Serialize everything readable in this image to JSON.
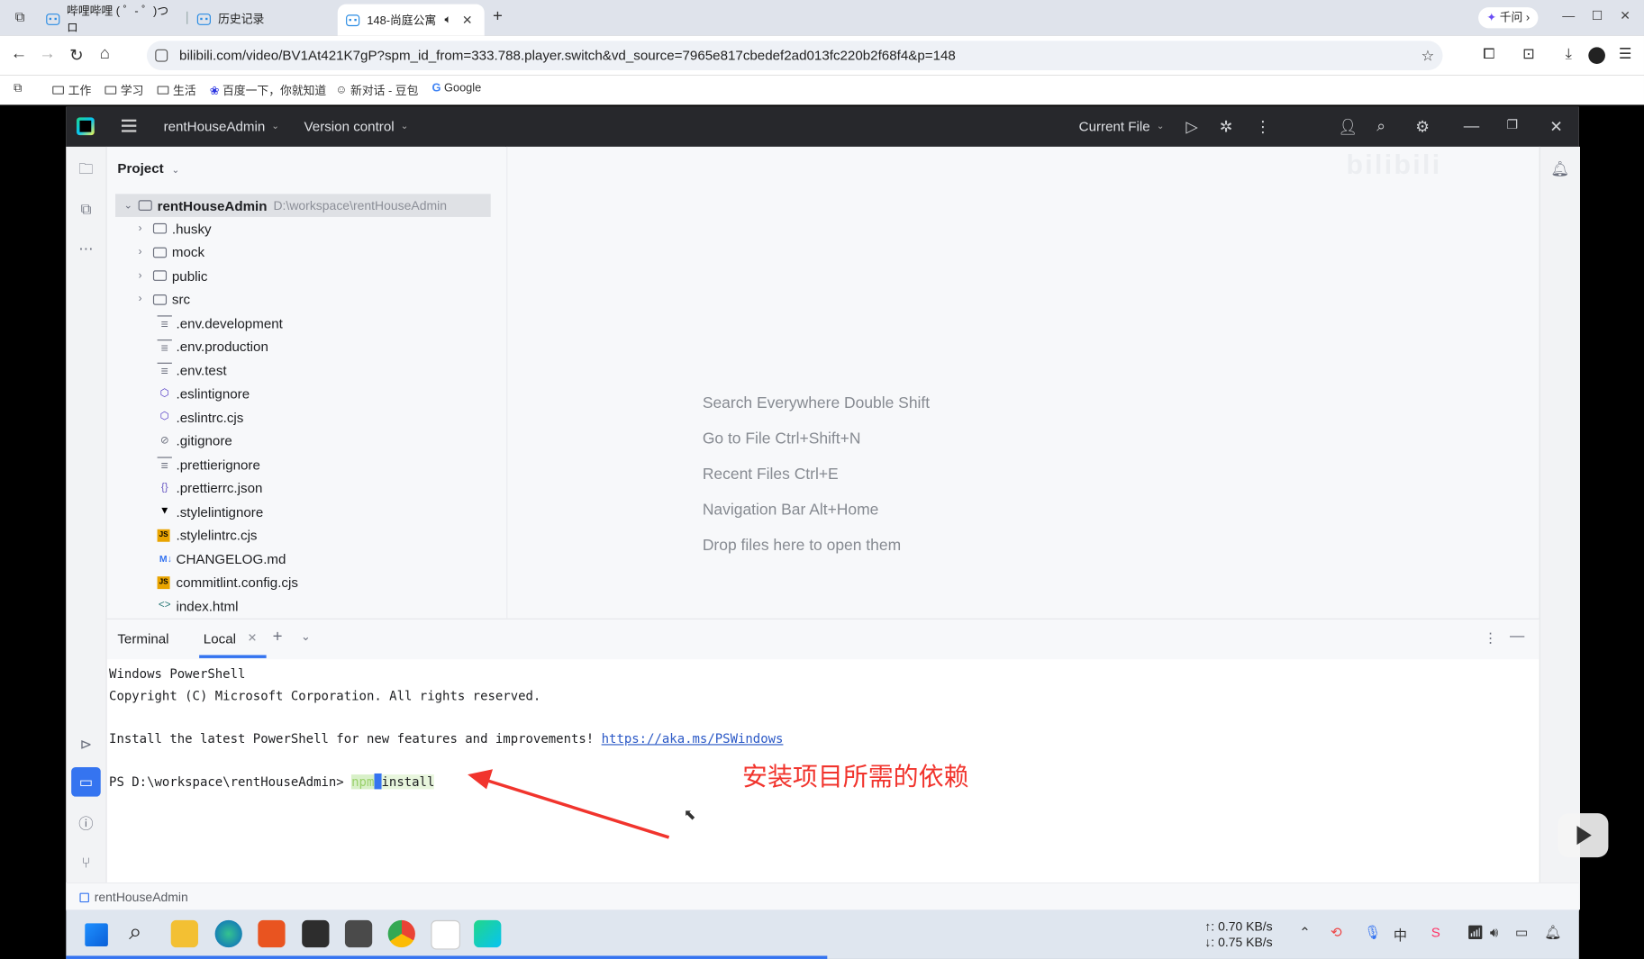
{
  "browser": {
    "tabs": [
      {
        "label": "哔哩哔哩 ( ゜- ゜)つロ"
      },
      {
        "label": "历史记录"
      },
      {
        "label": "148-尚庭公寓"
      }
    ],
    "qianwen": "千问",
    "url": "bilibili.com/video/BV1At421K7gP?spm_id_from=333.788.player.switch&vd_source=7965e817cbedef2ad013fc220b2f68f4&p=148",
    "bookmarks": [
      "工作",
      "学习",
      "生活",
      "百度一下，你就知道",
      "新对话 - 豆包",
      "Google"
    ]
  },
  "ide": {
    "project_name": "rentHouseAdmin",
    "version_control": "Version control",
    "run_config": "Current File",
    "project_panel_title": "Project",
    "root": {
      "name": "rentHouseAdmin",
      "path": "D:\\workspace\\rentHouseAdmin"
    },
    "folders": [
      ".husky",
      "mock",
      "public",
      "src"
    ],
    "files": [
      {
        "name": ".env.development",
        "icon": "text-file-icon"
      },
      {
        "name": ".env.production",
        "icon": "text-file-icon"
      },
      {
        "name": ".env.test",
        "icon": "text-file-icon"
      },
      {
        "name": ".eslintignore",
        "icon": "eslint-icon"
      },
      {
        "name": ".eslintrc.cjs",
        "icon": "eslint-icon"
      },
      {
        "name": ".gitignore",
        "icon": "ignore-icon"
      },
      {
        "name": ".prettierignore",
        "icon": "text-file-icon"
      },
      {
        "name": ".prettierrc.json",
        "icon": "json-icon"
      },
      {
        "name": ".stylelintignore",
        "icon": "stylelint-icon"
      },
      {
        "name": ".stylelintrc.cjs",
        "icon": "js-icon"
      },
      {
        "name": "CHANGELOG.md",
        "icon": "markdown-icon"
      },
      {
        "name": "commitlint.config.cjs",
        "icon": "js-icon"
      },
      {
        "name": "index.html",
        "icon": "html-icon"
      }
    ],
    "editor_hints": [
      "Search Everywhere Double Shift",
      "Go to File Ctrl+Shift+N",
      "Recent Files Ctrl+E",
      "Navigation Bar Alt+Home",
      "Drop files here to open them"
    ],
    "terminal": {
      "title": "Terminal",
      "tab": "Local",
      "lines": [
        "Windows PowerShell",
        "Copyright (C) Microsoft Corporation. All rights reserved.",
        "",
        "Install the latest PowerShell for new features and improvements! "
      ],
      "link": "https://aka.ms/PSWindows",
      "prompt": "PS D:\\workspace\\rentHouseAdmin> ",
      "cmd_npm": "npm",
      "cmd_rest": "install",
      "annotation": "安装项目所需的依赖"
    },
    "status_path": "rentHouseAdmin"
  },
  "taskbar": {
    "upload": "↑: 0.70 KB/s",
    "download": "↓: 0.75 KB/s"
  },
  "colors": {
    "accent": "#3574f0",
    "annotation": "#f1342d",
    "ide_title_bg": "#27282c"
  }
}
